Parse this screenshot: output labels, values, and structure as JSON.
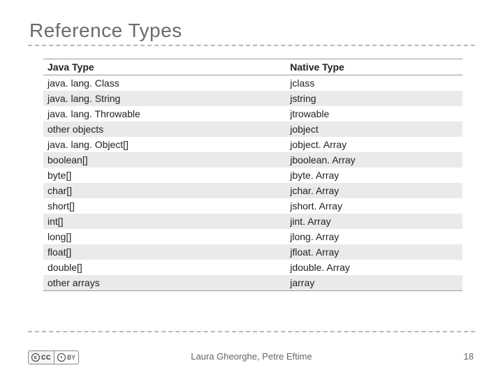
{
  "title": "Reference Types",
  "table": {
    "headers": [
      "Java Type",
      "Native Type"
    ],
    "rows": [
      [
        "java. lang. Class",
        "jclass"
      ],
      [
        "java. lang. String",
        "jstring"
      ],
      [
        "java. lang. Throwable",
        "jtrowable"
      ],
      [
        "other objects",
        "jobject"
      ],
      [
        "java. lang. Object[]",
        "jobject. Array"
      ],
      [
        "boolean[]",
        "jboolean. Array"
      ],
      [
        "byte[]",
        "jbyte. Array"
      ],
      [
        "char[]",
        "jchar. Array"
      ],
      [
        "short[]",
        "jshort. Array"
      ],
      [
        "int[]",
        "jint. Array"
      ],
      [
        "long[]",
        "jlong. Array"
      ],
      [
        "float[]",
        "jfloat. Array"
      ],
      [
        "double[]",
        "jdouble. Array"
      ],
      [
        "other arrays",
        "jarray"
      ]
    ]
  },
  "footer": {
    "authors": "Laura Gheorghe, Petre Eftime",
    "page_number": "18",
    "license_cc": "CC",
    "license_by": "BY"
  }
}
